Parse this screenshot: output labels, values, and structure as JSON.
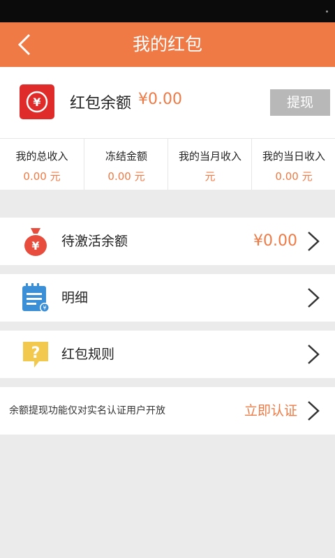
{
  "header": {
    "title": "我的红包",
    "back_icon": "chevron-left-icon"
  },
  "balance": {
    "label": "红包余额",
    "value": "¥0.00",
    "withdraw_label": "提现",
    "icon": "red-wallet-icon"
  },
  "stats": [
    {
      "label": "我的总收入",
      "value": "0.00 元"
    },
    {
      "label": "冻结金额",
      "value": "0.00 元"
    },
    {
      "label": "我的当月收入",
      "value": "元"
    },
    {
      "label": "我的当日收入",
      "value": "0.00 元"
    }
  ],
  "menu": [
    {
      "label": "待激活余额",
      "value": "¥0.00",
      "icon": "money-bag-icon"
    },
    {
      "label": "明细",
      "icon": "notepad-icon"
    },
    {
      "label": "红包规则",
      "icon": "question-bubble-icon"
    }
  ],
  "notice": {
    "text": "余额提现功能仅对实名认证用户开放",
    "link_label": "立即认证"
  },
  "colors": {
    "accent": "#ef7a45",
    "background": "#ebebeb",
    "button_gray": "#b8b8b8"
  }
}
